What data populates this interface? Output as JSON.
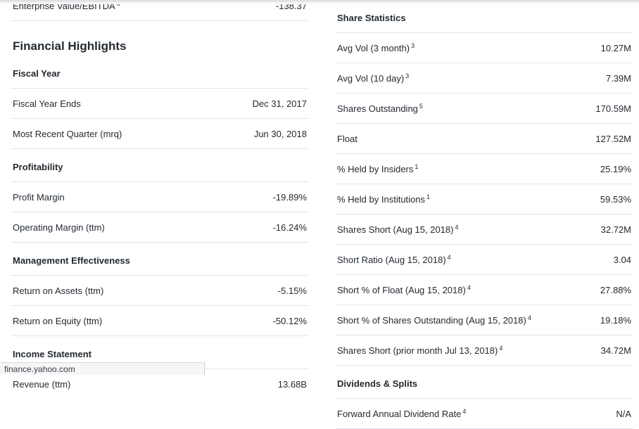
{
  "colors": {
    "text": "#232a31",
    "divider": "#e0e4e9",
    "page_background": "#ffffff",
    "status_bar_background": "#f5f6f7"
  },
  "status_bar": {
    "url": "finance.yahoo.com"
  },
  "left_column": {
    "top_partial_row": {
      "label": "Enterprise Value/EBITDA",
      "sup": "6",
      "value": "-138.37"
    },
    "section_title": "Financial Highlights",
    "groups": [
      {
        "title": "Fiscal Year",
        "rows": [
          {
            "label": "Fiscal Year Ends",
            "sup": "",
            "value": "Dec 31, 2017"
          },
          {
            "label": "Most Recent Quarter (mrq)",
            "sup": "",
            "value": "Jun 30, 2018"
          }
        ]
      },
      {
        "title": "Profitability",
        "rows": [
          {
            "label": "Profit Margin",
            "sup": "",
            "value": "-19.89%"
          },
          {
            "label": "Operating Margin (ttm)",
            "sup": "",
            "value": "-16.24%"
          }
        ]
      },
      {
        "title": "Management Effectiveness",
        "rows": [
          {
            "label": "Return on Assets (ttm)",
            "sup": "",
            "value": "-5.15%"
          },
          {
            "label": "Return on Equity (ttm)",
            "sup": "",
            "value": "-50.12%"
          }
        ]
      },
      {
        "title": "Income Statement",
        "rows": [
          {
            "label": "Revenue (ttm)",
            "sup": "",
            "value": "13.68B"
          }
        ]
      }
    ]
  },
  "right_column": {
    "groups": [
      {
        "title": "Share Statistics",
        "rows": [
          {
            "label": "Avg Vol (3 month)",
            "sup": "3",
            "value": "10.27M"
          },
          {
            "label": "Avg Vol (10 day)",
            "sup": "3",
            "value": "7.39M"
          },
          {
            "label": "Shares Outstanding",
            "sup": "5",
            "value": "170.59M"
          },
          {
            "label": "Float",
            "sup": "",
            "value": "127.52M"
          },
          {
            "label": "% Held by Insiders",
            "sup": "1",
            "value": "25.19%"
          },
          {
            "label": "% Held by Institutions",
            "sup": "1",
            "value": "59.53%"
          },
          {
            "label": "Shares Short (Aug 15, 2018)",
            "sup": "4",
            "value": "32.72M"
          },
          {
            "label": "Short Ratio (Aug 15, 2018)",
            "sup": "4",
            "value": "3.04"
          },
          {
            "label": "Short % of Float (Aug 15, 2018)",
            "sup": "4",
            "value": "27.88%"
          },
          {
            "label": "Short % of Shares Outstanding (Aug 15, 2018)",
            "sup": "4",
            "value": "19.18%"
          },
          {
            "label": "Shares Short (prior month Jul 13, 2018)",
            "sup": "4",
            "value": "34.72M"
          }
        ]
      },
      {
        "title": "Dividends & Splits",
        "rows": [
          {
            "label": "Forward Annual Dividend Rate",
            "sup": "4",
            "value": "N/A"
          }
        ]
      }
    ]
  }
}
